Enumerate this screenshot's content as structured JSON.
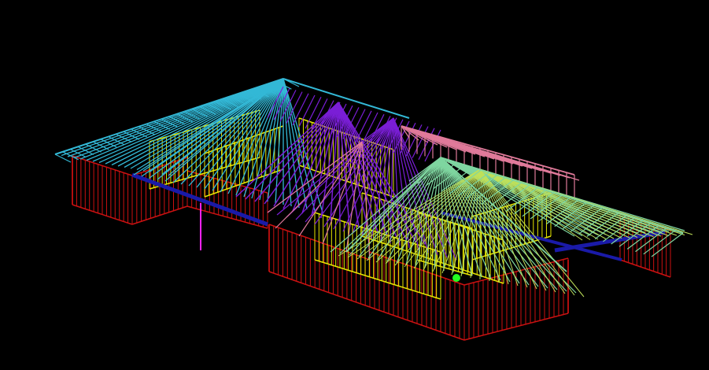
{
  "viewport": {
    "background": "#000000",
    "model": "3d-wireframe-house-frame"
  },
  "colors": {
    "walls": "#cc1111",
    "studs_inner": "#e6e600",
    "top_plate": "#1a1aa8",
    "truss_cyan": "#33b8d6",
    "truss_purple": "#7a1ed6",
    "truss_pink": "#e07a9a",
    "truss_green": "#7fd6a0",
    "truss_yellowgreen": "#bfe05a",
    "axis_magenta": "#ff22ff",
    "ucs_marker": "#22ff22"
  }
}
